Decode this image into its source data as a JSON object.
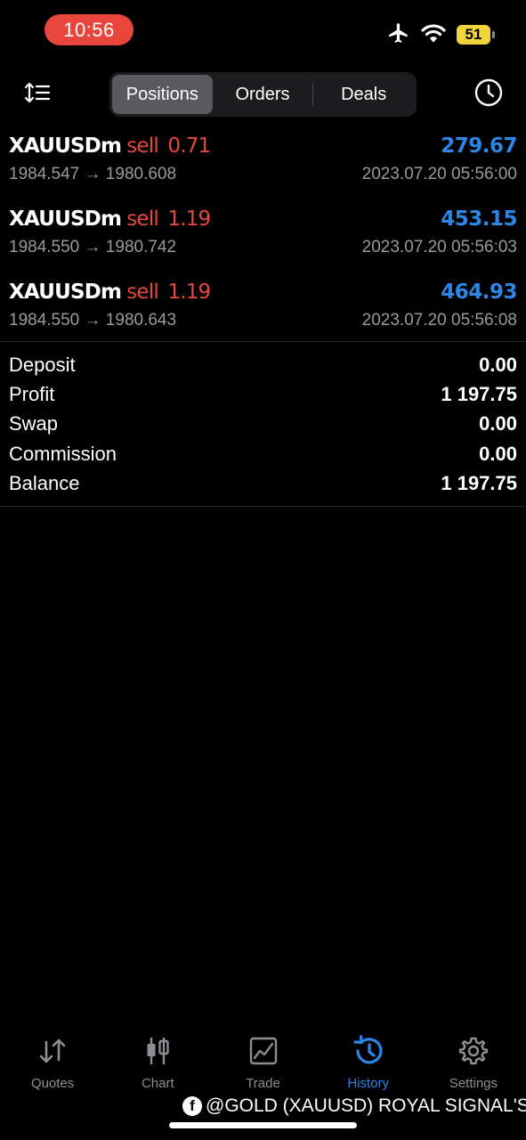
{
  "status_bar": {
    "time": "10:56",
    "battery": "51"
  },
  "toolbar": {
    "segments": [
      {
        "label": "Positions",
        "active": true
      },
      {
        "label": "Orders",
        "active": false
      },
      {
        "label": "Deals",
        "active": false
      }
    ]
  },
  "deals": [
    {
      "symbol": "XAUUSDm",
      "side": "sell",
      "volume": "0.71",
      "profit": "279.67",
      "prices": "1984.547 → 1980.608",
      "time": "2023.07.20 05:56:00"
    },
    {
      "symbol": "XAUUSDm",
      "side": "sell",
      "volume": "1.19",
      "profit": "453.15",
      "prices": "1984.550 → 1980.742",
      "time": "2023.07.20 05:56:03"
    },
    {
      "symbol": "XAUUSDm",
      "side": "sell",
      "volume": "1.19",
      "profit": "464.93",
      "prices": "1984.550 → 1980.643",
      "time": "2023.07.20 05:56:08"
    }
  ],
  "summary": [
    {
      "label": "Deposit",
      "value": "0.00"
    },
    {
      "label": "Profit",
      "value": "1 197.75"
    },
    {
      "label": "Swap",
      "value": "0.00"
    },
    {
      "label": "Commission",
      "value": "0.00"
    },
    {
      "label": "Balance",
      "value": "1 197.75"
    }
  ],
  "tabbar": [
    {
      "label": "Quotes",
      "icon": "quotes-icon",
      "active": false
    },
    {
      "label": "Chart",
      "icon": "chart-icon",
      "active": false
    },
    {
      "label": "Trade",
      "icon": "trade-icon",
      "active": false
    },
    {
      "label": "History",
      "icon": "history-icon",
      "active": true
    },
    {
      "label": "Settings",
      "icon": "settings-icon",
      "active": false
    }
  ],
  "watermark": {
    "text": "@GOLD (XAUUSD) ROYAL SIGNAL'S",
    "icon": "facebook-icon"
  },
  "colors": {
    "accent": "#2e86e6",
    "sell": "#e5483c",
    "time_pill": "#e8463c",
    "battery": "#f1d33b"
  }
}
